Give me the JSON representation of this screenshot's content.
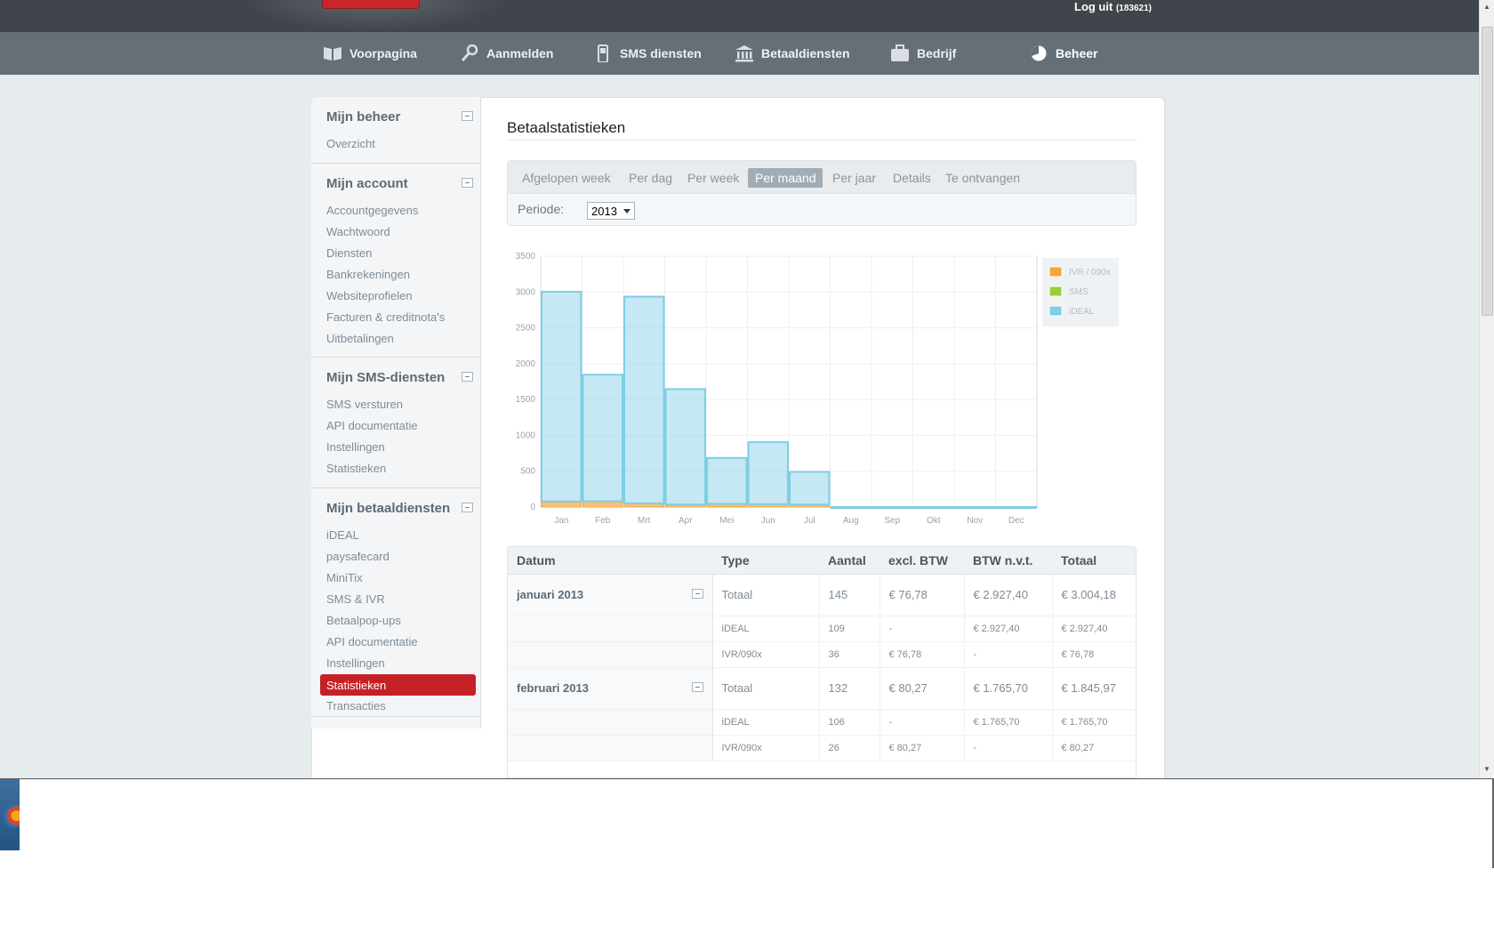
{
  "header": {
    "logout_label": "Log uit",
    "user_id": "(183621)"
  },
  "nav": {
    "items": [
      {
        "label": "Voorpagina",
        "icon": "book-icon"
      },
      {
        "label": "Aanmelden",
        "icon": "key-icon"
      },
      {
        "label": "SMS diensten",
        "icon": "phone-icon"
      },
      {
        "label": "Betaaldiensten",
        "icon": "bank-icon"
      },
      {
        "label": "Bedrijf",
        "icon": "briefcase-icon"
      },
      {
        "label": "Beheer",
        "icon": "pie-icon"
      }
    ],
    "active": "Beheer"
  },
  "sidebar": {
    "sections": [
      {
        "title": "Mijn beheer",
        "links": [
          "Overzicht"
        ]
      },
      {
        "title": "Mijn account",
        "links": [
          "Accountgegevens",
          "Wachtwoord",
          "Diensten",
          "Bankrekeningen",
          "Websiteprofielen",
          "Facturen & creditnota's",
          "Uitbetalingen"
        ]
      },
      {
        "title": "Mijn SMS-diensten",
        "links": [
          "SMS versturen",
          "API documentatie",
          "Instellingen",
          "Statistieken"
        ]
      },
      {
        "title": "Mijn betaaldiensten",
        "links": [
          "iDEAL",
          "paysafecard",
          "MiniTix",
          "SMS & IVR",
          "Betaalpop-ups",
          "API documentatie",
          "Instellingen",
          "Statistieken",
          "Transacties"
        ]
      }
    ],
    "active_link": "Statistieken"
  },
  "main": {
    "title": "Betaalstatistieken",
    "tabs": [
      "Afgelopen week",
      "Per dag",
      "Per week",
      "Per maand",
      "Per jaar",
      "Details",
      "Te ontvangen"
    ],
    "active_tab": "Per maand",
    "periode_label": "Periode:",
    "periode_value": "2013"
  },
  "chart_data": {
    "type": "bar",
    "stacked": true,
    "categories": [
      "Jan",
      "Feb",
      "Mrt",
      "Apr",
      "Mei",
      "Jun",
      "Jul",
      "Aug",
      "Sep",
      "Okt",
      "Nov",
      "Dec"
    ],
    "series": [
      {
        "name": "IVR / 090x",
        "color": "#f7a634",
        "values": [
          77,
          80,
          51,
          36,
          45,
          40,
          35,
          0,
          0,
          0,
          0,
          0
        ]
      },
      {
        "name": "SMS",
        "color": "#9ccc3a",
        "values": [
          0,
          0,
          0,
          0,
          0,
          0,
          0,
          0,
          0,
          0,
          0,
          0
        ]
      },
      {
        "name": "iDEAL",
        "color": "#7fcde6",
        "values": [
          2927,
          1766,
          2884,
          1610,
          640,
          865,
          455,
          0,
          0,
          0,
          0,
          0
        ]
      }
    ],
    "ylim": [
      0,
      3500
    ],
    "yticks": [
      0,
      500,
      1000,
      1500,
      2000,
      2500,
      3000,
      3500
    ],
    "grid": true,
    "legend": "top-right"
  },
  "table": {
    "headers": [
      "Datum",
      "Type",
      "Aantal",
      "excl. BTW",
      "BTW n.v.t.",
      "Totaal"
    ],
    "groups": [
      {
        "month": "januari 2013",
        "rows": [
          [
            "Totaal",
            "145",
            "€ 76,78",
            "€ 2.927,40",
            "€ 3.004,18"
          ],
          [
            "iDEAL",
            "109",
            "-",
            "€ 2.927,40",
            "€ 2.927,40"
          ],
          [
            "IVR/090x",
            "36",
            "€ 76,78",
            "-",
            "€ 76,78"
          ]
        ]
      },
      {
        "month": "februari 2013",
        "rows": [
          [
            "Totaal",
            "132",
            "€ 80,27",
            "€ 1.765,70",
            "€ 1.845,97"
          ],
          [
            "iDEAL",
            "106",
            "-",
            "€ 1.765,70",
            "€ 1.765,70"
          ],
          [
            "IVR/090x",
            "26",
            "€ 80,27",
            "-",
            "€ 80,27"
          ]
        ]
      }
    ]
  }
}
